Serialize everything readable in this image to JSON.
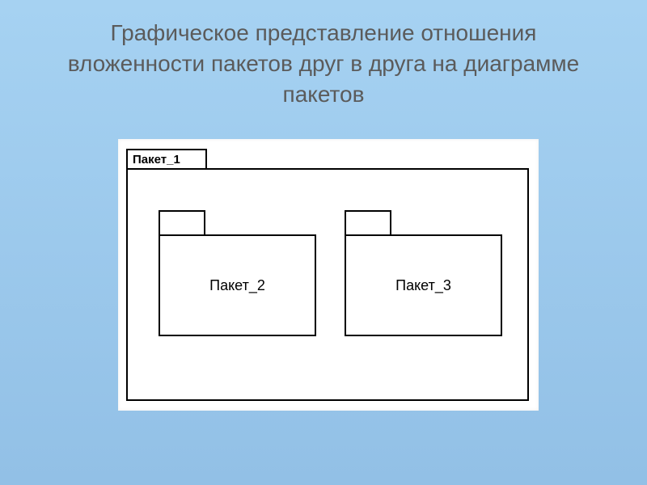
{
  "slide": {
    "title": "Графическое представление отношения вложенности пакетов друг в друга на диаграмме пакетов"
  },
  "diagram": {
    "outer_package_label": "Пакет_1",
    "inner_packages": {
      "p2": "Пакет_2",
      "p3": "Пакет_3"
    }
  }
}
